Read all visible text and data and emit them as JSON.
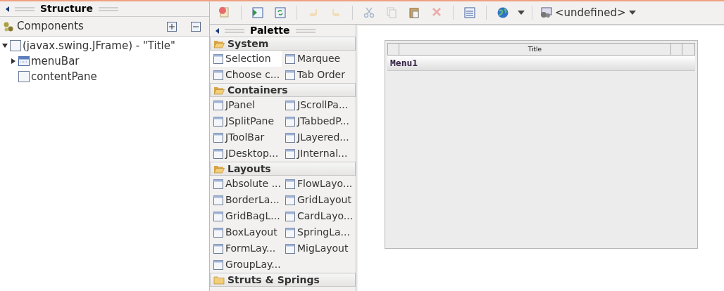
{
  "structure": {
    "title": "Structure",
    "components_label": "Components",
    "tree": [
      {
        "label": "(javax.swing.JFrame) - \"Title\"",
        "expanded": true,
        "children": [
          {
            "label": "menuBar",
            "expanded": false,
            "kind": "menubar"
          },
          {
            "label": "contentPane",
            "kind": "panel"
          }
        ]
      }
    ]
  },
  "toolbar": {
    "buttons": [
      {
        "kind": "test",
        "disabled": false
      },
      {
        "kind": "sep"
      },
      {
        "kind": "source",
        "disabled": false
      },
      {
        "kind": "refresh",
        "disabled": false
      },
      {
        "kind": "sep"
      },
      {
        "kind": "undo",
        "disabled": true
      },
      {
        "kind": "redo",
        "disabled": true
      },
      {
        "kind": "sep"
      },
      {
        "kind": "cut",
        "disabled": true
      },
      {
        "kind": "copy",
        "disabled": true
      },
      {
        "kind": "paste",
        "disabled": false
      },
      {
        "kind": "delete",
        "disabled": true
      },
      {
        "kind": "sep"
      },
      {
        "kind": "form",
        "disabled": false
      },
      {
        "kind": "sep"
      },
      {
        "kind": "globe",
        "disabled": false
      },
      {
        "kind": "sep"
      }
    ],
    "lookandfeel": "<undefined>"
  },
  "palette": {
    "title": "Palette",
    "categories": [
      {
        "name": "System",
        "expanded": true,
        "items": [
          {
            "label": "Selection",
            "selected": true
          },
          {
            "label": "Marquee",
            "selected": false
          },
          {
            "label": "Choose c...",
            "selected": false
          },
          {
            "label": "Tab Order",
            "selected": false
          }
        ]
      },
      {
        "name": "Containers",
        "expanded": true,
        "items": [
          {
            "label": "JPanel",
            "selected": false
          },
          {
            "label": "JScrollPa...",
            "selected": false
          },
          {
            "label": "JSplitPane",
            "selected": false
          },
          {
            "label": "JTabbedP...",
            "selected": false
          },
          {
            "label": "JToolBar",
            "selected": false
          },
          {
            "label": "JLayered...",
            "selected": false
          },
          {
            "label": "JDesktop...",
            "selected": false
          },
          {
            "label": "JInternal...",
            "selected": false
          }
        ]
      },
      {
        "name": "Layouts",
        "expanded": true,
        "items": [
          {
            "label": "Absolute ...",
            "selected": false
          },
          {
            "label": "FlowLayo...",
            "selected": false
          },
          {
            "label": "BorderLa...",
            "selected": false
          },
          {
            "label": "GridLayout",
            "selected": false
          },
          {
            "label": "GridBagL...",
            "selected": false
          },
          {
            "label": "CardLayo...",
            "selected": false
          },
          {
            "label": "BoxLayout",
            "selected": false
          },
          {
            "label": "SpringLa...",
            "selected": false
          },
          {
            "label": "FormLay...",
            "selected": false
          },
          {
            "label": "MigLayout",
            "selected": false
          },
          {
            "label": "GroupLay...",
            "selected": false
          }
        ]
      },
      {
        "name": "Struts & Springs",
        "expanded": false
      }
    ]
  },
  "design": {
    "frame_title": "Title",
    "menu": "Menu1"
  }
}
